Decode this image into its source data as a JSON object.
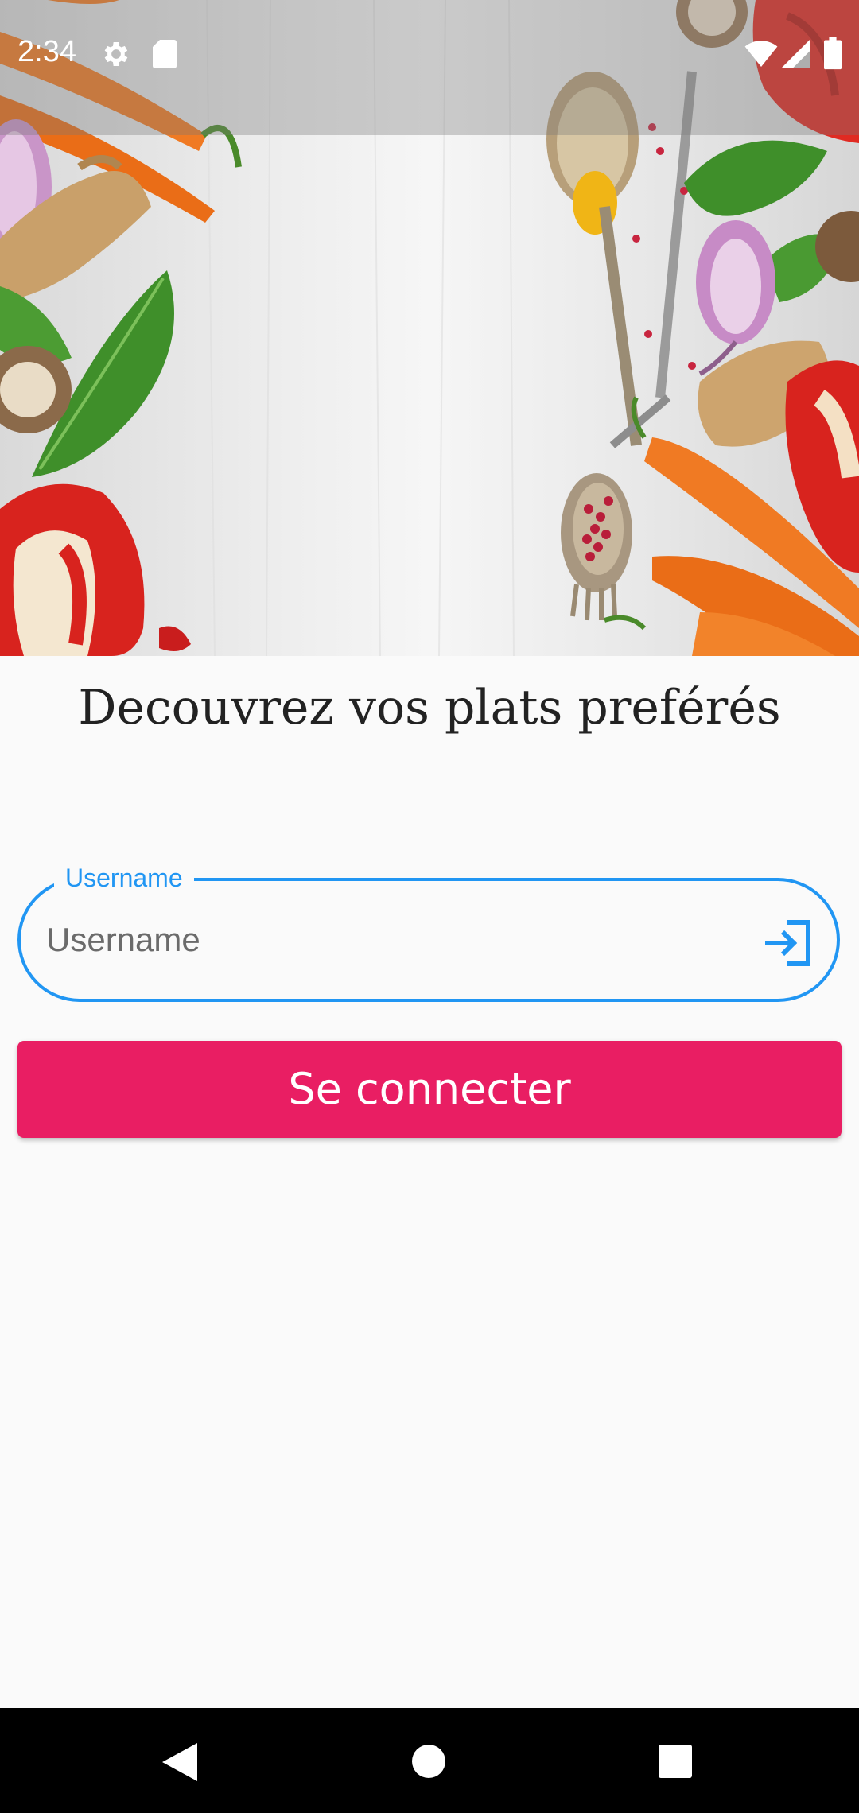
{
  "status_bar": {
    "time": "2:34",
    "icons": [
      "gear-icon",
      "sd-card-icon",
      "wifi-icon",
      "signal-icon",
      "battery-icon"
    ]
  },
  "hero": {
    "description_icon": "vegetables-image"
  },
  "title": "Decouvrez vos plats preférés",
  "username_field": {
    "label": "Username",
    "placeholder": "Username",
    "value": "",
    "icon": "login-icon"
  },
  "connect_button": {
    "label": "Se connecter"
  },
  "nav_bar": {
    "icons": [
      "back-icon",
      "home-icon",
      "recents-icon"
    ]
  },
  "colors": {
    "accent": "#2196f3",
    "button": "#e91e63",
    "background": "#fafafa"
  }
}
